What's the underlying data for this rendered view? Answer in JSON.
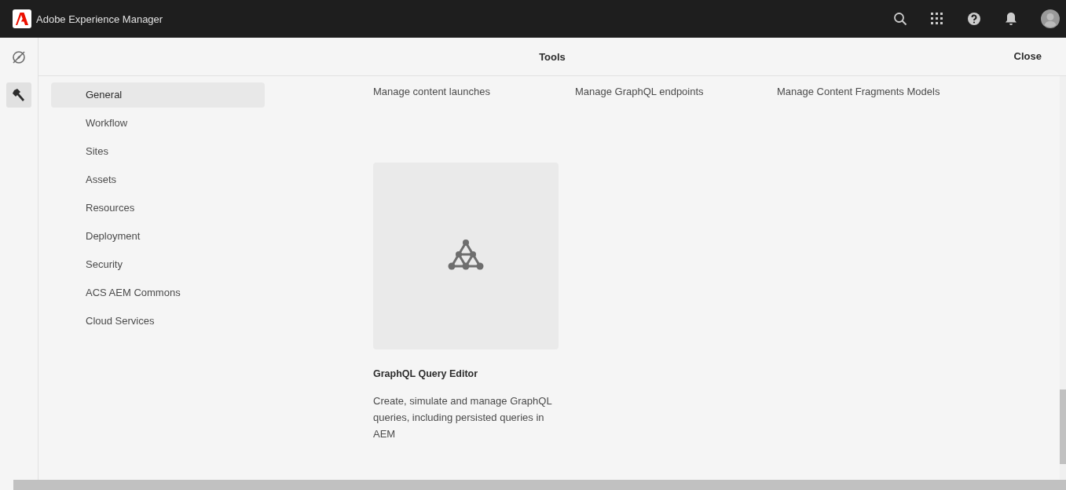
{
  "header": {
    "title": "Adobe Experience Manager"
  },
  "rail": [
    {
      "kind": "navigation",
      "selected": false
    },
    {
      "kind": "tools",
      "selected": true
    }
  ],
  "panel": {
    "title": "Tools",
    "close": "Close"
  },
  "nav": [
    {
      "label": "General",
      "selected": true
    },
    {
      "label": "Workflow",
      "selected": false
    },
    {
      "label": "Sites",
      "selected": false
    },
    {
      "label": "Assets",
      "selected": false
    },
    {
      "label": "Resources",
      "selected": false
    },
    {
      "label": "Deployment",
      "selected": false
    },
    {
      "label": "Security",
      "selected": false
    },
    {
      "label": "ACS AEM Commons",
      "selected": false
    },
    {
      "label": "Cloud Services",
      "selected": false
    }
  ],
  "tool_captions": [
    "Manage content launches",
    "Manage GraphQL endpoints",
    "Manage Content Fragments Models"
  ],
  "cards": [
    {
      "title": "GraphQL Query Editor",
      "description": "Create, simulate and manage GraphQL queries, including persisted queries in AEM"
    }
  ]
}
